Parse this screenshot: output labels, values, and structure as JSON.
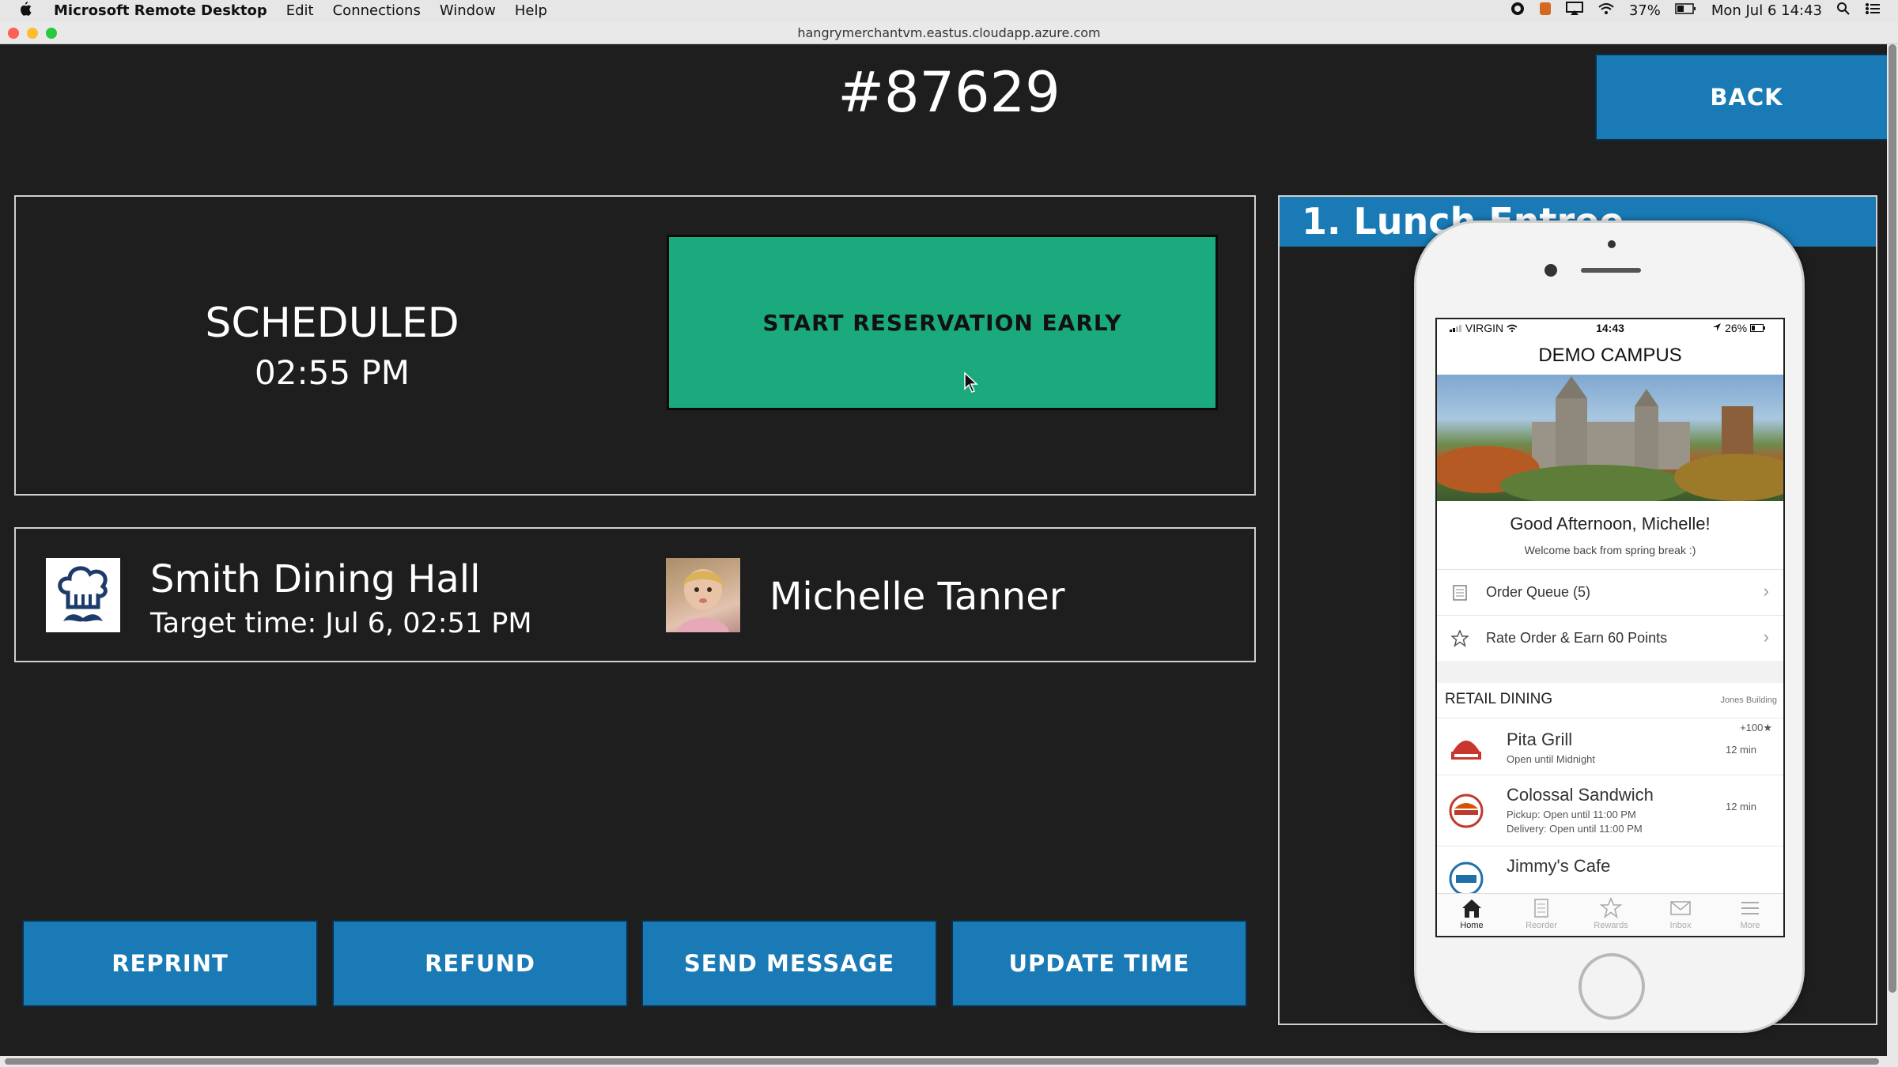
{
  "menubar": {
    "app_name": "Microsoft Remote Desktop",
    "menus": [
      "Edit",
      "Connections",
      "Window",
      "Help"
    ],
    "battery": "37%",
    "datetime": "Mon Jul 6 14:43"
  },
  "window": {
    "title": "hangrymerchantvm.eastus.cloudapp.azure.com"
  },
  "order": {
    "number": "#87629",
    "back_label": "BACK",
    "status": "SCHEDULED",
    "status_time": "02:55 PM",
    "start_early_label": "START RESERVATION EARLY",
    "location": "Smith Dining Hall",
    "target_time": "Target time: Jul 6, 02:51 PM",
    "customer": "Michelle Tanner"
  },
  "actions": {
    "reprint": "REPRINT",
    "refund": "REFUND",
    "send_message": "SEND MESSAGE",
    "update_time": "UPDATE TIME"
  },
  "right_panel": {
    "header": "1. Lunch Entree"
  },
  "phone": {
    "carrier": "VIRGIN",
    "time": "14:43",
    "battery": "26%",
    "campus": "DEMO CAMPUS",
    "greeting": "Good Afternoon, Michelle!",
    "welcome": "Welcome back from spring break :)",
    "rows": [
      {
        "label": "Order Queue (5)",
        "icon": "receipt-icon"
      },
      {
        "label": "Rate Order & Earn 60 Points",
        "icon": "star-outline-icon"
      }
    ],
    "retail_header": "RETAIL DINING",
    "retail_location": "Jones Building",
    "restaurants": [
      {
        "name": "Pita Grill",
        "sub1": "Open until Midnight",
        "sub2": "",
        "time": "12 min",
        "badge": "+100★"
      },
      {
        "name": "Colossal Sandwich",
        "sub1": "Pickup: Open until 11:00 PM",
        "sub2": "Delivery: Open until 11:00 PM",
        "time": "12 min",
        "badge": ""
      },
      {
        "name": "Jimmy's Cafe",
        "sub1": "",
        "sub2": "",
        "time": "",
        "badge": ""
      }
    ],
    "tabs": [
      "Home",
      "Reorder",
      "Rewards",
      "Inbox",
      "More"
    ]
  },
  "colors": {
    "blue": "#1a7ab5",
    "green": "#1aaa7e",
    "background": "#1e1e1e"
  }
}
